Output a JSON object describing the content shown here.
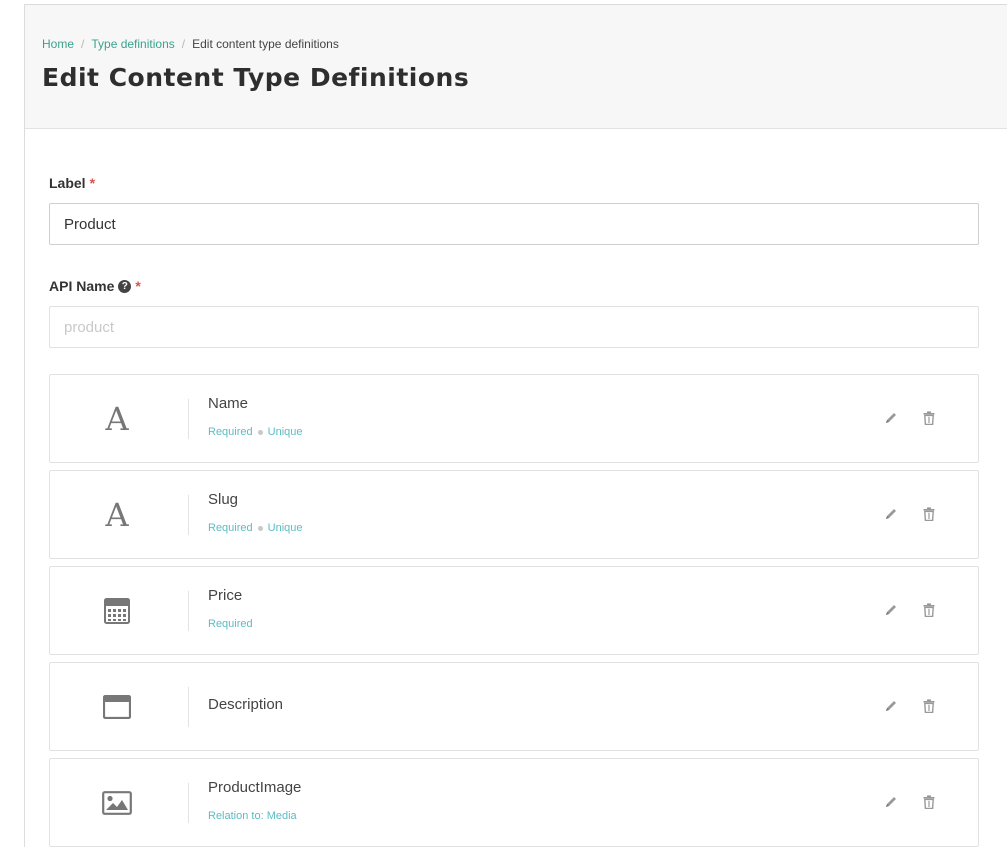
{
  "breadcrumb": {
    "home": "Home",
    "sep": "/",
    "type_definitions": "Type definitions",
    "current": "Edit content type definitions"
  },
  "page_title": "Edit Content Type Definitions",
  "form": {
    "label": {
      "title": "Label",
      "required_mark": "*",
      "value": "Product"
    },
    "api_name": {
      "title": "API Name",
      "help_glyph": "?",
      "required_mark": "*",
      "placeholder": "product"
    }
  },
  "fields": [
    {
      "name": "Name",
      "icon": "text-icon",
      "glyph": "A",
      "required": "Required",
      "unique": "Unique"
    },
    {
      "name": "Slug",
      "icon": "text-icon",
      "glyph": "A",
      "required": "Required",
      "unique": "Unique"
    },
    {
      "name": "Price",
      "icon": "calculator-icon",
      "required": "Required"
    },
    {
      "name": "Description",
      "icon": "richtext-window-icon"
    },
    {
      "name": "ProductImage",
      "icon": "image-icon",
      "relation": "Relation to: Media"
    }
  ],
  "colors": {
    "link": "#3aa38c",
    "meta": "#5bbcc4",
    "required": "#d9534f"
  }
}
